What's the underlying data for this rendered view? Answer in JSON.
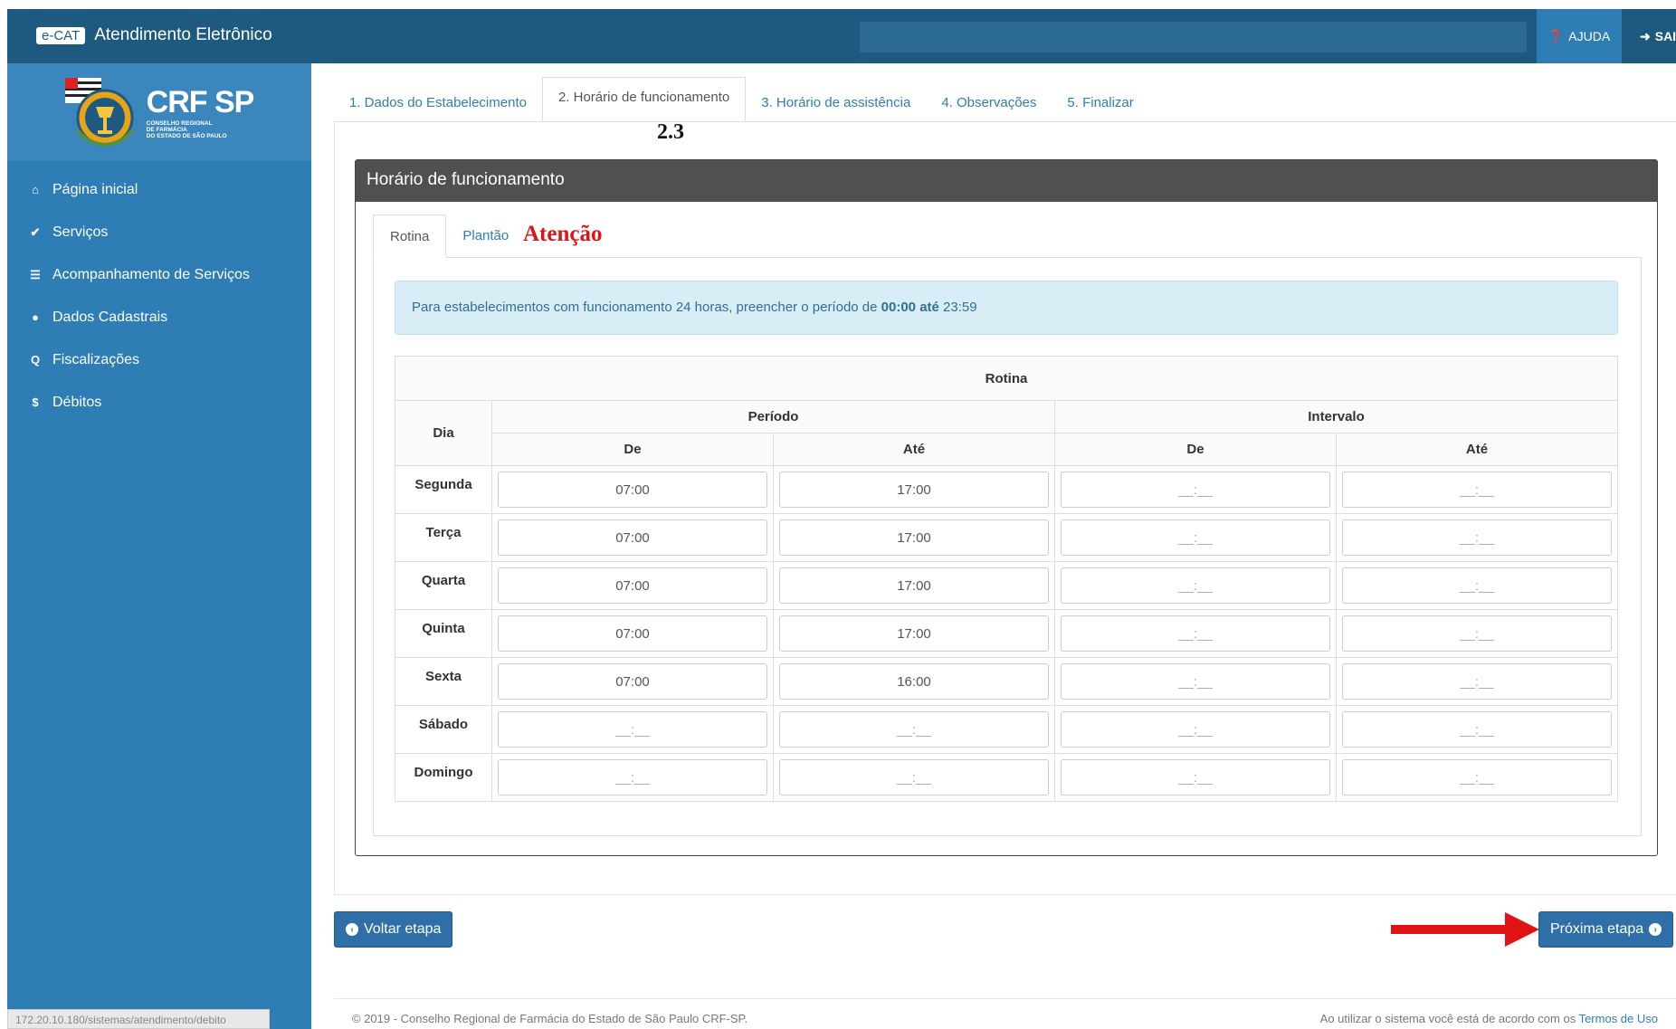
{
  "header": {
    "badge": "e-CAT",
    "title": "Atendimento Eletrônico",
    "help_label": "AJUDA",
    "exit_label": "SAIR"
  },
  "logo": {
    "main": "CRF SP",
    "sub1": "CONSELHO REGIONAL",
    "sub2": "DE FARMÁCIA",
    "sub3": "DO ESTADO DE SÃO PAULO"
  },
  "sidebar": {
    "items": [
      {
        "label": "Página inicial",
        "icon": "home-icon"
      },
      {
        "label": "Serviços",
        "icon": "check-icon"
      },
      {
        "label": "Acompanhamento de Serviços",
        "icon": "list-icon"
      },
      {
        "label": "Dados Cadastrais",
        "icon": "user-icon"
      },
      {
        "label": "Fiscalizações",
        "icon": "search-icon"
      },
      {
        "label": "Débitos",
        "icon": "dollar-icon"
      }
    ]
  },
  "status_url": "172.20.10.180/sistemas/atendimento/debito",
  "tabs": [
    "1. Dados do Estabelecimento",
    "2. Horário de funcionamento",
    "3. Horário de assistência",
    "4. Observações",
    "5. Finalizar"
  ],
  "annotations": {
    "step": "2.3",
    "attention": "Atenção"
  },
  "panel": {
    "title": "Horário de funcionamento",
    "inner_tabs": [
      "Rotina",
      "Plantão"
    ],
    "alert_prefix": "Para estabelecimentos com funcionamento 24 horas, preencher o período de ",
    "alert_bold1": "00:00",
    "alert_mid": " até ",
    "alert_bold2": "23:59"
  },
  "table": {
    "caption": "Rotina",
    "col_day": "Dia",
    "group_period": "Período",
    "group_interval": "Intervalo",
    "sub_from": "De",
    "sub_to": "Até",
    "placeholder": "__:__",
    "rows": [
      {
        "day": "Segunda",
        "p_from": "07:00",
        "p_to": "17:00",
        "i_from": "",
        "i_to": ""
      },
      {
        "day": "Terça",
        "p_from": "07:00",
        "p_to": "17:00",
        "i_from": "",
        "i_to": ""
      },
      {
        "day": "Quarta",
        "p_from": "07:00",
        "p_to": "17:00",
        "i_from": "",
        "i_to": ""
      },
      {
        "day": "Quinta",
        "p_from": "07:00",
        "p_to": "17:00",
        "i_from": "",
        "i_to": ""
      },
      {
        "day": "Sexta",
        "p_from": "07:00",
        "p_to": "16:00",
        "i_from": "",
        "i_to": ""
      },
      {
        "day": "Sábado",
        "p_from": "",
        "p_to": "",
        "i_from": "",
        "i_to": ""
      },
      {
        "day": "Domingo",
        "p_from": "",
        "p_to": "",
        "i_from": "",
        "i_to": ""
      }
    ]
  },
  "buttons": {
    "back": "Voltar etapa",
    "next": "Próxima etapa"
  },
  "footer": {
    "copyright": "© 2019 - Conselho Regional de Farmácia do Estado de São Paulo CRF-SP.",
    "terms_prefix": "Ao utilizar o sistema você está de acordo com os ",
    "terms_link": "Termos de Uso"
  },
  "colors": {
    "primary": "#2e7db4",
    "header": "#1e5a80",
    "panel_head": "#505050",
    "annotation_red": "#e01414"
  }
}
